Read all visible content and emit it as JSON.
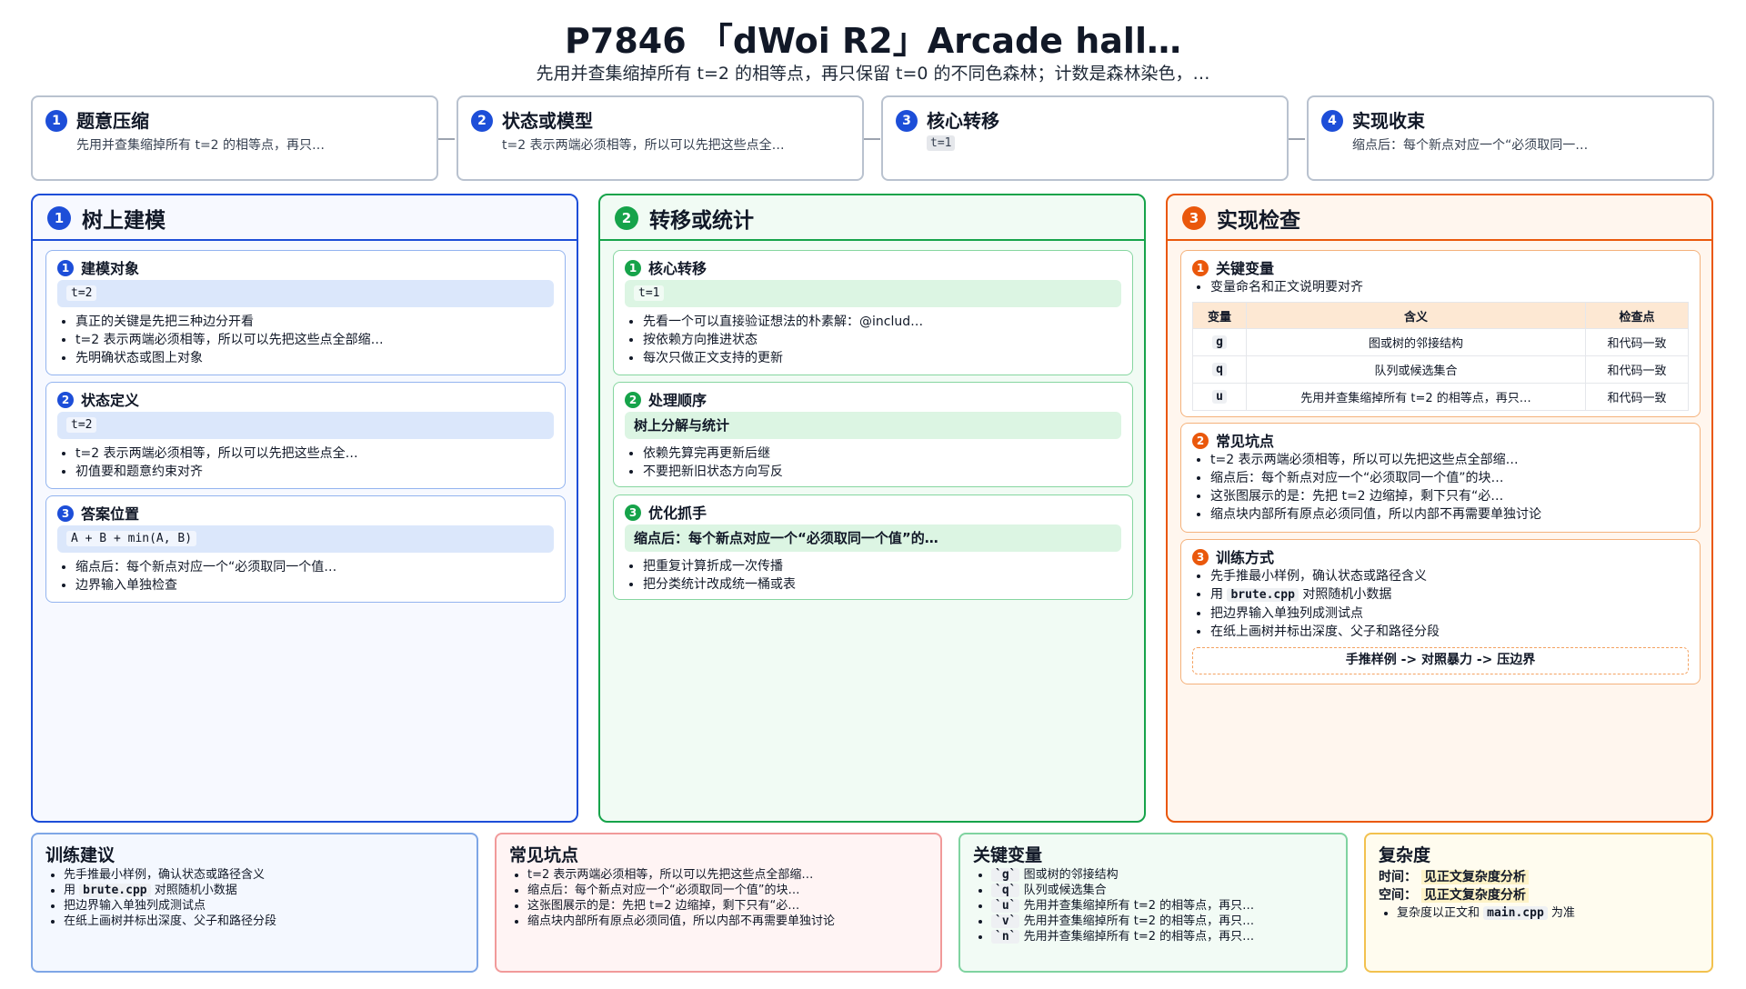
{
  "header": {
    "title": "P7846 「dWoi R2」Arcade hall…",
    "subtitle": "先用并查集缩掉所有 t=2 的相等点，再只保留 t=0 的不同色森林；计数是森林染色，…"
  },
  "steps": [
    {
      "num": "1",
      "title": "题意压缩",
      "desc": "先用并查集缩掉所有 t=2 的相等点，再只…"
    },
    {
      "num": "2",
      "title": "状态或模型",
      "desc": "t=2 表示两端必须相等，所以可以先把这些点全…"
    },
    {
      "num": "3",
      "title": "核心转移",
      "code": "t=1"
    },
    {
      "num": "4",
      "title": "实现收束",
      "desc": "缩点后：每个新点对应一个“必须取同一…"
    }
  ],
  "columns": {
    "left": {
      "num": "1",
      "title": "树上建模",
      "cards": [
        {
          "num": "1",
          "title": "建模对象",
          "code": "t=2",
          "bullets": [
            "真正的关键是先把三种边分开看",
            "t=2 表示两端必须相等，所以可以先把这些点全部缩…",
            "先明确状态或图上对象"
          ]
        },
        {
          "num": "2",
          "title": "状态定义",
          "code": "t=2",
          "bullets": [
            "t=2 表示两端必须相等，所以可以先把这些点全…",
            "初值要和题意约束对齐"
          ]
        },
        {
          "num": "3",
          "title": "答案位置",
          "code": "A + B + min(A, B)",
          "bullets": [
            "缩点后：每个新点对应一个“必须取同一个值…",
            "边界输入单独检查"
          ]
        }
      ]
    },
    "middle": {
      "num": "2",
      "title": "转移或统计",
      "cards": [
        {
          "num": "1",
          "title": "核心转移",
          "code": "t=1",
          "bullets": [
            "先看一个可以直接验证想法的朴素解：@includ…",
            "按依赖方向推进状态",
            "每次只做正文支持的更新"
          ]
        },
        {
          "num": "2",
          "title": "处理顺序",
          "bold": "树上分解与统计",
          "bullets": [
            "依赖先算完再更新后继",
            "不要把新旧状态方向写反"
          ]
        },
        {
          "num": "3",
          "title": "优化抓手",
          "bold": "缩点后：每个新点对应一个“必须取同一个值”的…",
          "bullets": [
            "把重复计算折成一次传播",
            "把分类统计改成统一桶或表"
          ]
        }
      ]
    },
    "right": {
      "num": "3",
      "title": "实现检查",
      "vars": {
        "num": "1",
        "title": "关键变量",
        "bullet": "变量命名和正文说明要对齐",
        "headers": [
          "变量",
          "含义",
          "检查点"
        ],
        "rows": [
          [
            "g",
            "图或树的邻接结构",
            "和代码一致"
          ],
          [
            "q",
            "队列或候选集合",
            "和代码一致"
          ],
          [
            "u",
            "先用并查集缩掉所有 t=2 的相等点，再只…",
            "和代码一致"
          ]
        ]
      },
      "pitfalls": {
        "num": "2",
        "title": "常见坑点",
        "bullets": [
          "t=2 表示两端必须相等，所以可以先把这些点全部缩…",
          "缩点后：每个新点对应一个“必须取同一个值”的块…",
          "这张图展示的是：先把 t=2 边缩掉，剩下只有“必…",
          "缩点块内部所有原点必须同值，所以内部不再需要单独讨论"
        ]
      },
      "training": {
        "num": "3",
        "title": "训练方式",
        "b1": "先手推最小样例，确认状态或路径含义",
        "b2_pre": "用",
        "b2_code": "brute.cpp",
        "b2_post": "对照随机小数据",
        "b3": "把边界输入单独列成测试点",
        "b4": "在纸上画树并标出深度、父子和路径分段",
        "flow": "手推样例 -> 对照暴力 -> 压边界"
      }
    }
  },
  "bottom": {
    "advice": {
      "title": "训练建议",
      "b1": "先手推最小样例，确认状态或路径含义",
      "b2_pre": "用",
      "b2_code": "brute.cpp",
      "b2_post": "对照随机小数据",
      "b3": "把边界输入单独列成测试点",
      "b4": "在纸上画树并标出深度、父子和路径分段"
    },
    "pitfalls": {
      "title": "常见坑点",
      "bullets": [
        "t=2 表示两端必须相等，所以可以先把这些点全部缩…",
        "缩点后：每个新点对应一个“必须取同一个值”的块…",
        "这张图展示的是：先把 t=2 边缩掉，剩下只有“必…",
        "缩点块内部所有原点必须同值，所以内部不再需要单独讨论"
      ]
    },
    "vars": {
      "title": "关键变量",
      "items": [
        {
          "code": "`g`",
          "text": "图或树的邻接结构"
        },
        {
          "code": "`q`",
          "text": "队列或候选集合"
        },
        {
          "code": "`u`",
          "text": "先用并查集缩掉所有 t=2 的相等点，再只…"
        },
        {
          "code": "`v`",
          "text": "先用并查集缩掉所有 t=2 的相等点，再只…"
        },
        {
          "code": "`n`",
          "text": "先用并查集缩掉所有 t=2 的相等点，再只…"
        }
      ]
    },
    "complexity": {
      "title": "复杂度",
      "time_label": "时间：",
      "time_value": "见正文复杂度分析",
      "space_label": "空间：",
      "space_value": "见正文复杂度分析",
      "note_pre": "复杂度以正文和",
      "note_code": "main.cpp",
      "note_post": "为准"
    }
  },
  "colors": {
    "blue": "#1d4ed8",
    "green": "#16a34a",
    "orange": "#ea580c"
  }
}
